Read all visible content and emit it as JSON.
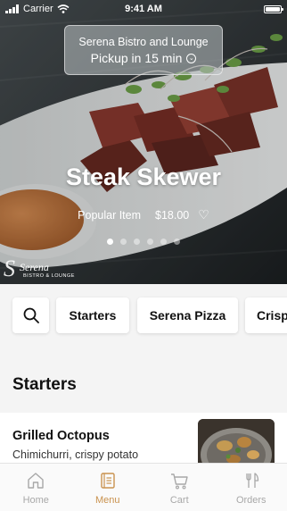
{
  "status_bar": {
    "carrier": "Carrier",
    "time": "9:41 AM"
  },
  "pickup": {
    "restaurant": "Serena Bistro and Lounge",
    "pickup_text": "Pickup in 15 min"
  },
  "hero": {
    "title": "Steak Skewer",
    "tag": "Popular Item",
    "price": "$18.00",
    "carousel": {
      "count": 6,
      "active": 0
    }
  },
  "logo": {
    "word": "Serena",
    "sub": "BISTRO & LOUNGE"
  },
  "categories": [
    "Starters",
    "Serena Pizza",
    "Crisp"
  ],
  "menu": {
    "section_title": "Starters",
    "items": [
      {
        "name": "Grilled Octopus",
        "description": "Chimichurri, crispy potato"
      }
    ]
  },
  "tabs": [
    {
      "label": "Home",
      "icon": "home-icon",
      "active": false
    },
    {
      "label": "Menu",
      "icon": "menu-book-icon",
      "active": true
    },
    {
      "label": "Cart",
      "icon": "cart-icon",
      "active": false
    },
    {
      "label": "Orders",
      "icon": "fork-knife-icon",
      "active": false
    }
  ],
  "colors": {
    "accent": "#c9924e",
    "inactive_tab": "#a8a8a8",
    "background": "#f4f4f4"
  }
}
